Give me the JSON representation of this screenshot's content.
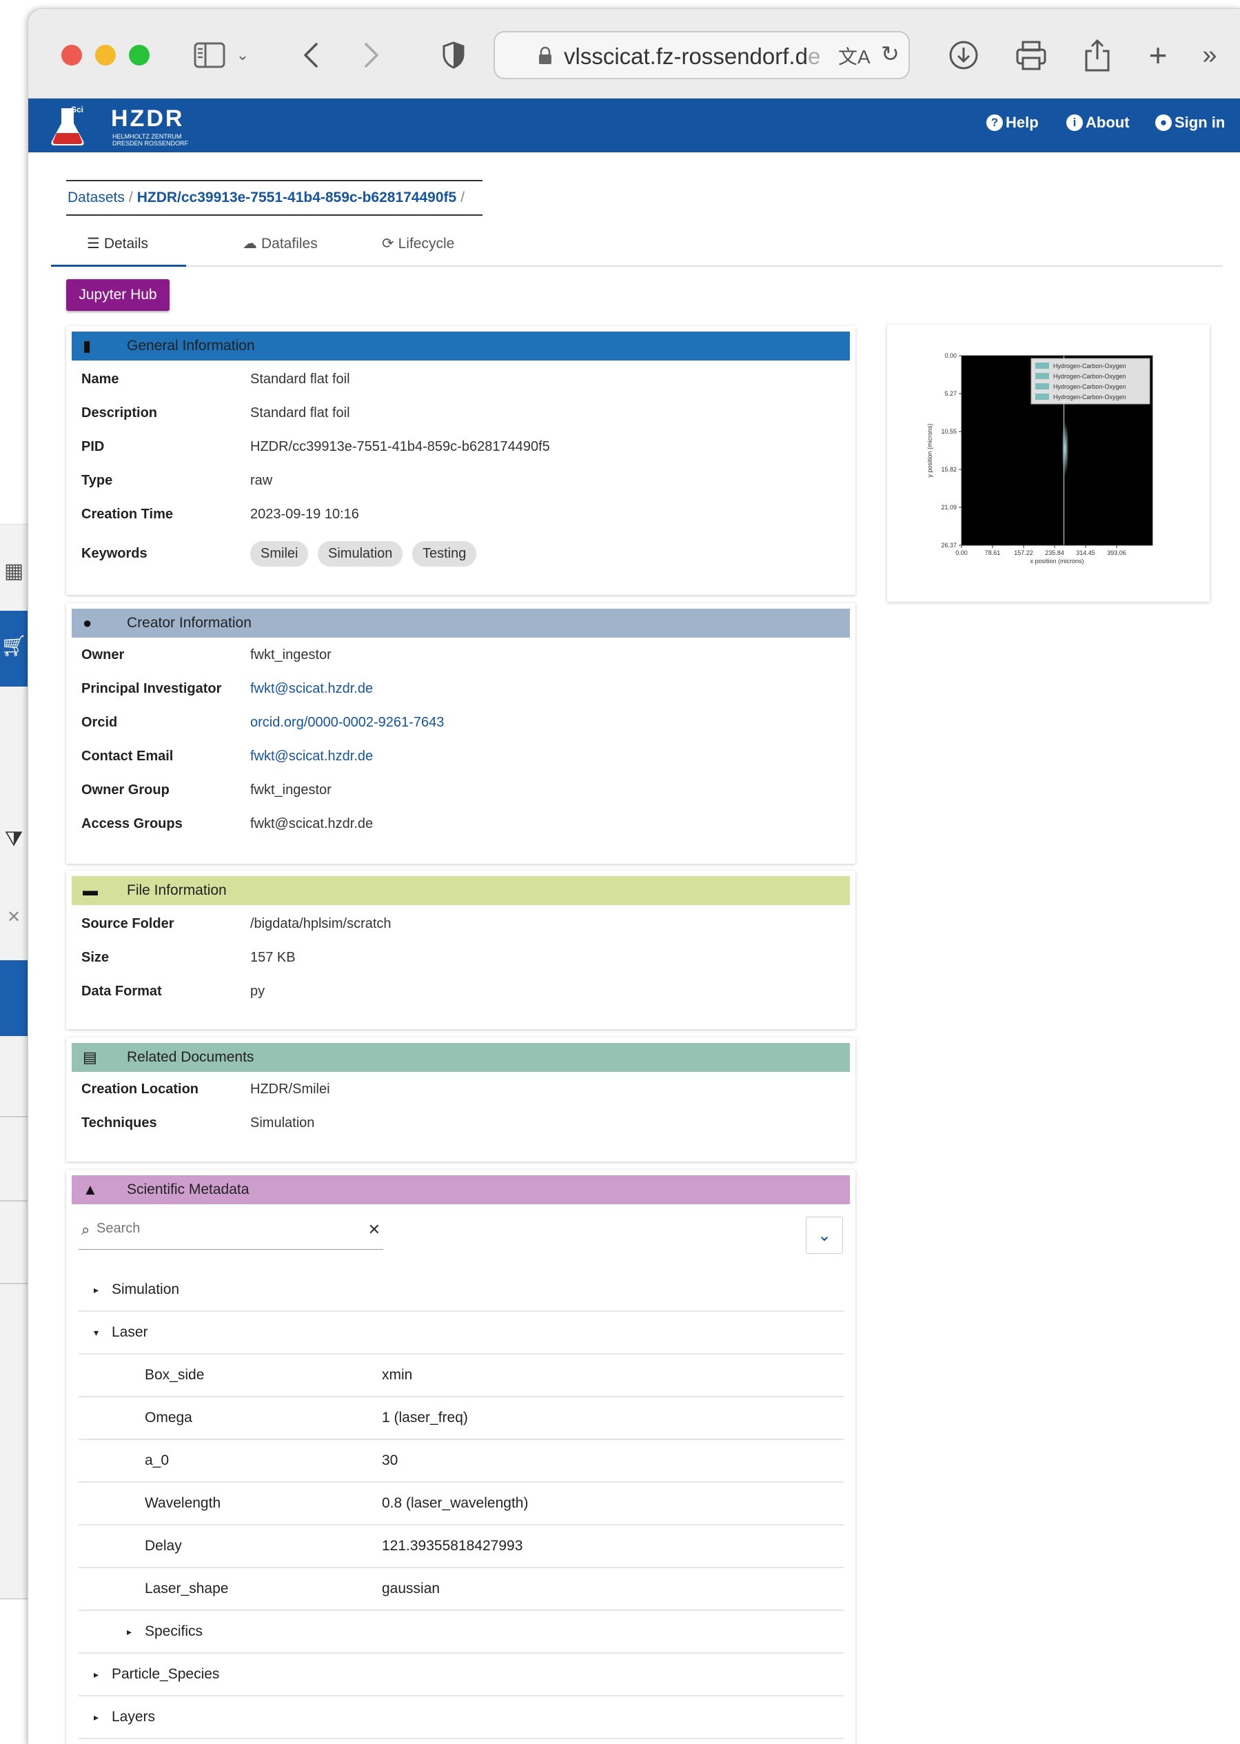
{
  "browser": {
    "url": "vlsscicat.fz-rossendorf.d",
    "url_fade": "e"
  },
  "app": {
    "logo_scicat": "SciCat",
    "logo_hzdr": "HZDR",
    "logo_sub1": "HELMHOLTZ ZENTRUM",
    "logo_sub2": "DRESDEN ROSSENDORF",
    "nav": {
      "help": "Help",
      "about": "About",
      "signin": "Sign in"
    }
  },
  "breadcrumb": {
    "root": "Datasets",
    "sep1": "/",
    "pid": "HZDR/cc39913e-7551-41b4-859c-b628174490f5",
    "sep2": "/"
  },
  "tabs": {
    "details": "Details",
    "datafiles": "Datafiles",
    "lifecycle": "Lifecycle"
  },
  "jupyter_label": "Jupyter Hub",
  "general": {
    "title": "General Information",
    "color": "#1f72b7",
    "rows": [
      {
        "label": "Name",
        "value": "Standard flat foil"
      },
      {
        "label": "Description",
        "value": "Standard flat foil"
      },
      {
        "label": "PID",
        "value": "HZDR/cc39913e-7551-41b4-859c-b628174490f5"
      },
      {
        "label": "Type",
        "value": "raw"
      },
      {
        "label": "Creation Time",
        "value": "2023-09-19 10:16"
      }
    ],
    "keywords_label": "Keywords",
    "keywords": [
      "Smilei",
      "Simulation",
      "Testing"
    ]
  },
  "creator": {
    "title": "Creator Information",
    "color": "#9fb4cb",
    "rows": [
      {
        "label": "Owner",
        "value": "fwkt_ingestor"
      },
      {
        "label": "Principal Investigator",
        "value": "fwkt@scicat.hzdr.de"
      },
      {
        "label": "Orcid",
        "value": "orcid.org/0000-0002-9261-7643"
      },
      {
        "label": "Contact Email",
        "value": "fwkt@scicat.hzdr.de"
      },
      {
        "label": "Owner Group",
        "value": "fwkt_ingestor"
      },
      {
        "label": "Access Groups",
        "value": "fwkt@scicat.hzdr.de"
      }
    ]
  },
  "file": {
    "title": "File Information",
    "color": "#d5e09b",
    "rows": [
      {
        "label": "Source Folder",
        "value": "/bigdata/hplsim/scratch"
      },
      {
        "label": "Size",
        "value": "157 KB"
      },
      {
        "label": "Data Format",
        "value": "py"
      }
    ]
  },
  "related": {
    "title": "Related Documents",
    "color": "#96c2b3",
    "rows": [
      {
        "label": "Creation Location",
        "value": "HZDR/Smilei"
      },
      {
        "label": "Techniques",
        "value": "Simulation"
      }
    ]
  },
  "scientific": {
    "title": "Scientific Metadata",
    "color": "#cd9ecd",
    "search_placeholder": "Search",
    "tree": [
      {
        "key": "Simulation",
        "expanded": false,
        "value": ""
      },
      {
        "key": "Laser",
        "expanded": true,
        "value": ""
      },
      {
        "key": "Box_side",
        "value": "xmin"
      },
      {
        "key": "Omega",
        "value": "1 (laser_freq)"
      },
      {
        "key": "a_0",
        "value": "30"
      },
      {
        "key": "Wavelength",
        "value": "0.8 (laser_wavelength)"
      },
      {
        "key": "Delay",
        "value": "121.39355818427993"
      },
      {
        "key": "Laser_shape",
        "value": "gaussian"
      },
      {
        "key": "Specifics",
        "expanded": false,
        "value": ""
      },
      {
        "key": "Particle_Species",
        "expanded": false,
        "value": ""
      },
      {
        "key": "Layers",
        "expanded": false,
        "value": ""
      }
    ]
  },
  "chart_data": {
    "type": "heatmap",
    "xlabel": "x position (microns)",
    "ylabel": "y position (microns)",
    "x_ticks": [
      "0.00",
      "78.61",
      "157.22",
      "235.84",
      "314.45",
      "393.06"
    ],
    "y_ticks": [
      "0.00",
      "5.27",
      "10.55",
      "15.82",
      "21.09",
      "26.37"
    ],
    "xlim": [
      0,
      440
    ],
    "ylim": [
      26.37,
      0
    ],
    "legend": [
      "Hydrogen-Carbon-Oxygen",
      "Hydrogen-Carbon-Oxygen",
      "Hydrogen-Carbon-Oxygen",
      "Hydrogen-Carbon-Oxygen"
    ],
    "legend_position": "top-right",
    "foil_x": 235.84,
    "colors": {
      "background": "#000000",
      "foil": "#bfe6e6",
      "legend_patch": "#7fbcbc"
    }
  }
}
